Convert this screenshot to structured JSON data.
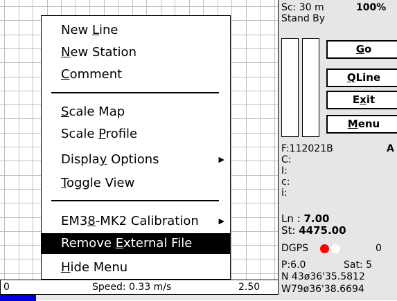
{
  "speedbar": {
    "left_value": "0",
    "speed_text": "Speed: 0.33 m/s",
    "right_value": "2.50",
    "progress": 0.13
  },
  "menu": {
    "items": [
      {
        "pre": "New ",
        "ul": "L",
        "post": "ine"
      },
      {
        "pre": "",
        "ul": "N",
        "post": "ew Station"
      },
      {
        "pre": "",
        "ul": "C",
        "post": "omment"
      },
      {
        "pre": "",
        "ul": "S",
        "post": "cale Map"
      },
      {
        "pre": "Scale ",
        "ul": "P",
        "post": "rofile"
      },
      {
        "pre": "Displa",
        "ul": "y",
        "post": " Options"
      },
      {
        "pre": "",
        "ul": "T",
        "post": "oggle View"
      },
      {
        "pre": "EM3",
        "ul": "8",
        "post": "-MK2 Calibration"
      },
      {
        "pre": "Remove ",
        "ul": "E",
        "post": "xternal File"
      },
      {
        "pre": "",
        "ul": "H",
        "post": "ide Menu"
      }
    ]
  },
  "panel": {
    "scale": "Sc:  30 m",
    "percent": "100%",
    "status": "Stand By",
    "buttons": {
      "go": {
        "ul": "G",
        "post": "o"
      },
      "qline": {
        "ul": "Q",
        "post": "Line"
      },
      "exit": {
        "pre": "E",
        "ul": "x",
        "post": "it"
      },
      "menu": {
        "ul": "M",
        "post": "enu"
      }
    },
    "file": "F:112021B",
    "file_flag": "A",
    "c_upper": "C:",
    "i_upper": "I:",
    "c_lower": "c:",
    "i_lower": "i:",
    "line_label": "Ln : ",
    "line_value": "7.00",
    "station_label": "St: ",
    "station_value": "4475.00",
    "dgps_label": "DGPS",
    "dgps_count": "0",
    "precision": "P:6.0",
    "satellites": "Sat:  5",
    "north": "N 43ø36'35.5812",
    "west": "W79ø36'38.6694"
  },
  "colors": {
    "highlight": "#000000",
    "gps_red": "#ff0000",
    "gps_white": "#ffffff",
    "progress_fill": "#0000d8"
  }
}
